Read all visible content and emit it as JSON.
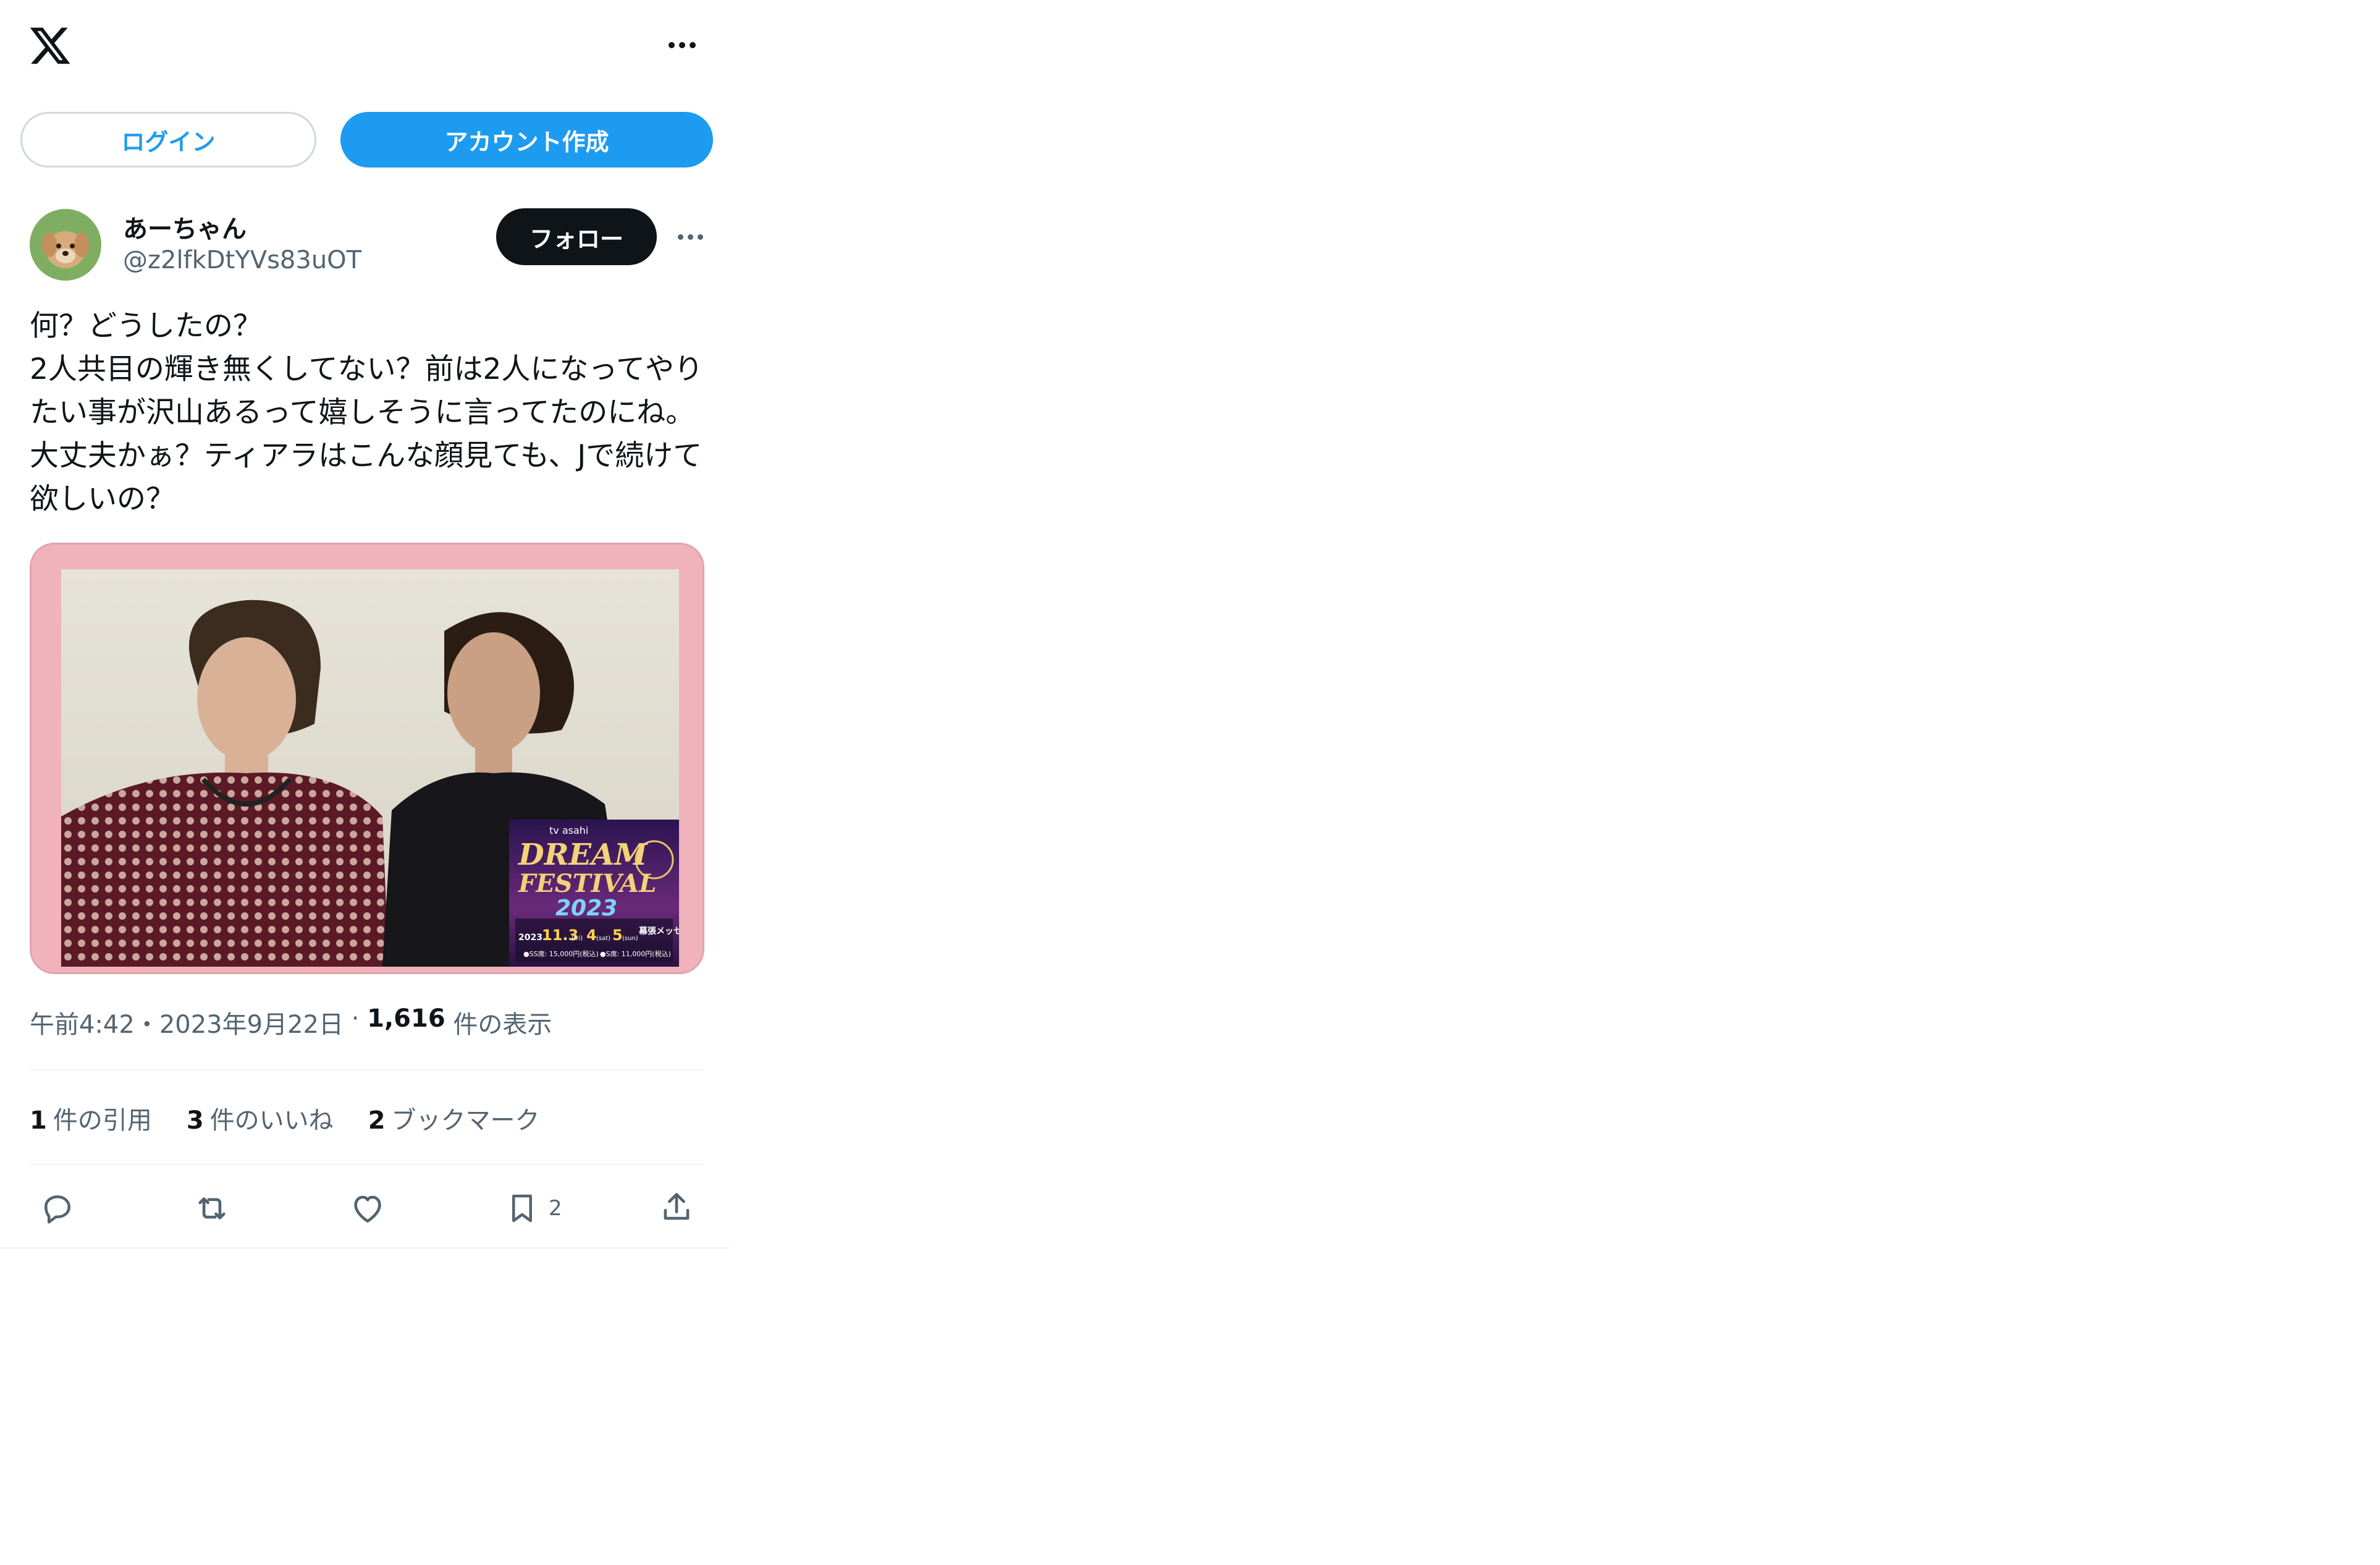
{
  "header": {
    "logo_icon": "x-logo-icon",
    "more_icon": "more-icon"
  },
  "auth": {
    "login_label": "ログイン",
    "signup_label": "アカウント作成"
  },
  "user": {
    "display_name": "あーちゃん",
    "handle": "@z2lfkDtYVs83uOT",
    "follow_label": "フォロー"
  },
  "tweet": {
    "text": "何？どうしたの？\n2人共目の輝き無くしてない？前は2人になってやりたい事が沢山あるって嬉しそうに言ってたのにね。大丈夫かぁ？ティアラはこんな顔見ても、Jで続けて欲しいの？",
    "media_overlay": {
      "brand": "tv asahi",
      "title_line1": "DREAM",
      "title_line2": "FESTIVAL",
      "year": "2023",
      "date_prefix": "2023.",
      "date_main": "11.3",
      "date_day1": "(fri)",
      "date_mid": "4",
      "date_day2": "(sat)",
      "date_end": "5",
      "date_day3": "(sun)",
      "venue": "幕張メッセ",
      "price1": "●SS席: 15,000円(税込)",
      "price2": "●S席: 11,000円(税込)"
    },
    "time": "午前4:42",
    "separator": "・",
    "date": "2023年9月22日",
    "views_separator": " · ",
    "views_count": "1,616",
    "views_label": " 件の表示"
  },
  "stats": {
    "quotes_count": "1",
    "quotes_label": "件の引用",
    "likes_count": "3",
    "likes_label": "件のいいね",
    "bookmarks_count": "2",
    "bookmarks_label": "ブックマーク"
  },
  "actions": {
    "reply_icon": "reply-icon",
    "retweet_icon": "retweet-icon",
    "like_icon": "heart-icon",
    "bookmark_icon": "bookmark-icon",
    "bookmark_count": "2",
    "share_icon": "share-icon"
  },
  "colors": {
    "accent": "#1d9bf0",
    "text": "#0f1419",
    "muted": "#536471",
    "border": "#cfd9de",
    "media_frame": "#f0b2bb"
  }
}
